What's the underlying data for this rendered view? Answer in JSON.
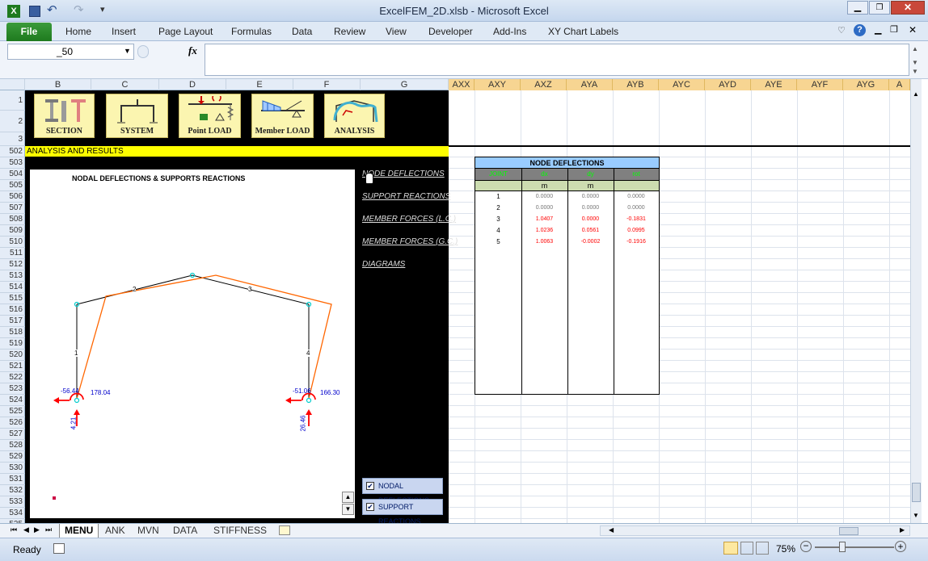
{
  "window": {
    "title": "ExcelFEM_2D.xlsb  -  Microsoft Excel"
  },
  "ribbon": {
    "file": "File",
    "tabs": [
      "Home",
      "Insert",
      "Page Layout",
      "Formulas",
      "Data",
      "Review",
      "View",
      "Developer",
      "Add-Ins",
      "XY Chart Labels"
    ]
  },
  "formula_bar": {
    "name_box": "_50",
    "fx": "fx",
    "formula": ""
  },
  "columns_left": [
    "B",
    "C",
    "D",
    "E",
    "F",
    "G"
  ],
  "columns_right": [
    "AXX",
    "AXY",
    "AXZ",
    "AYA",
    "AYB",
    "AYC",
    "AYD",
    "AYE",
    "AYF",
    "AYG",
    "A"
  ],
  "rows": [
    "1",
    "2",
    "3",
    "502",
    "503",
    "504",
    "505",
    "506",
    "507",
    "508",
    "509",
    "510",
    "511",
    "512",
    "513",
    "514",
    "515",
    "516",
    "517",
    "518",
    "519",
    "520",
    "521",
    "522",
    "523",
    "524",
    "525",
    "526",
    "527",
    "528",
    "529",
    "530",
    "531",
    "532",
    "533",
    "534",
    "535"
  ],
  "menu_buttons": [
    "SECTION",
    "SYSTEM",
    "Point  LOAD",
    "Member LOAD",
    "ANALYSIS"
  ],
  "banner": "ANALYSIS AND RESULTS",
  "diagram": {
    "title": "NODAL DEFLECTIONS & SUPPORTS REACTIONS",
    "members": [
      "1",
      "2",
      "3",
      "4"
    ],
    "left_support": {
      "moment": "178.04",
      "horizontal": "-56.44",
      "vertical": "4.21"
    },
    "right_support": {
      "moment": "166.30",
      "horizontal": "-51.06",
      "vertical": "26.46"
    }
  },
  "links": [
    "NODE DEFLECTIONS",
    "SUPPORT REACTIONS",
    "MEMBER FORCES (L.C.)",
    "MEMBER FORCES (G.C.)",
    "DIAGRAMS"
  ],
  "checkboxes": [
    {
      "label": "NODAL DEFLECTIONS",
      "checked": true,
      "mark": "✔"
    },
    {
      "label": "SUPPORT  REACTIONS",
      "checked": true,
      "mark": "✔"
    }
  ],
  "node_table": {
    "title": "NODE DEFLECTIONS",
    "headers": [
      "JOINT",
      "dx",
      "dy",
      "rot"
    ],
    "units": [
      "",
      "m",
      "m",
      "rad"
    ],
    "rows": [
      [
        "1",
        "0.0000",
        "0.0000",
        "0.0000"
      ],
      [
        "2",
        "0.0000",
        "0.0000",
        "0.0000"
      ],
      [
        "3",
        "1.0407",
        "0.0000",
        "-0.1831"
      ],
      [
        "4",
        "1.0236",
        "0.0561",
        "0.0995"
      ],
      [
        "5",
        "1.0063",
        "-0.0002",
        "-0.1916"
      ]
    ]
  },
  "sheets": [
    "MENU",
    "ANK",
    "MVN",
    "DATA",
    "STIFFNESS"
  ],
  "status": {
    "ready": "Ready",
    "zoom": "75%"
  },
  "colors": {
    "accent_yellow": "#ffff00",
    "table_header": "#99ccff",
    "deflected_shape": "#ff6600",
    "reaction": "#ff0000"
  }
}
